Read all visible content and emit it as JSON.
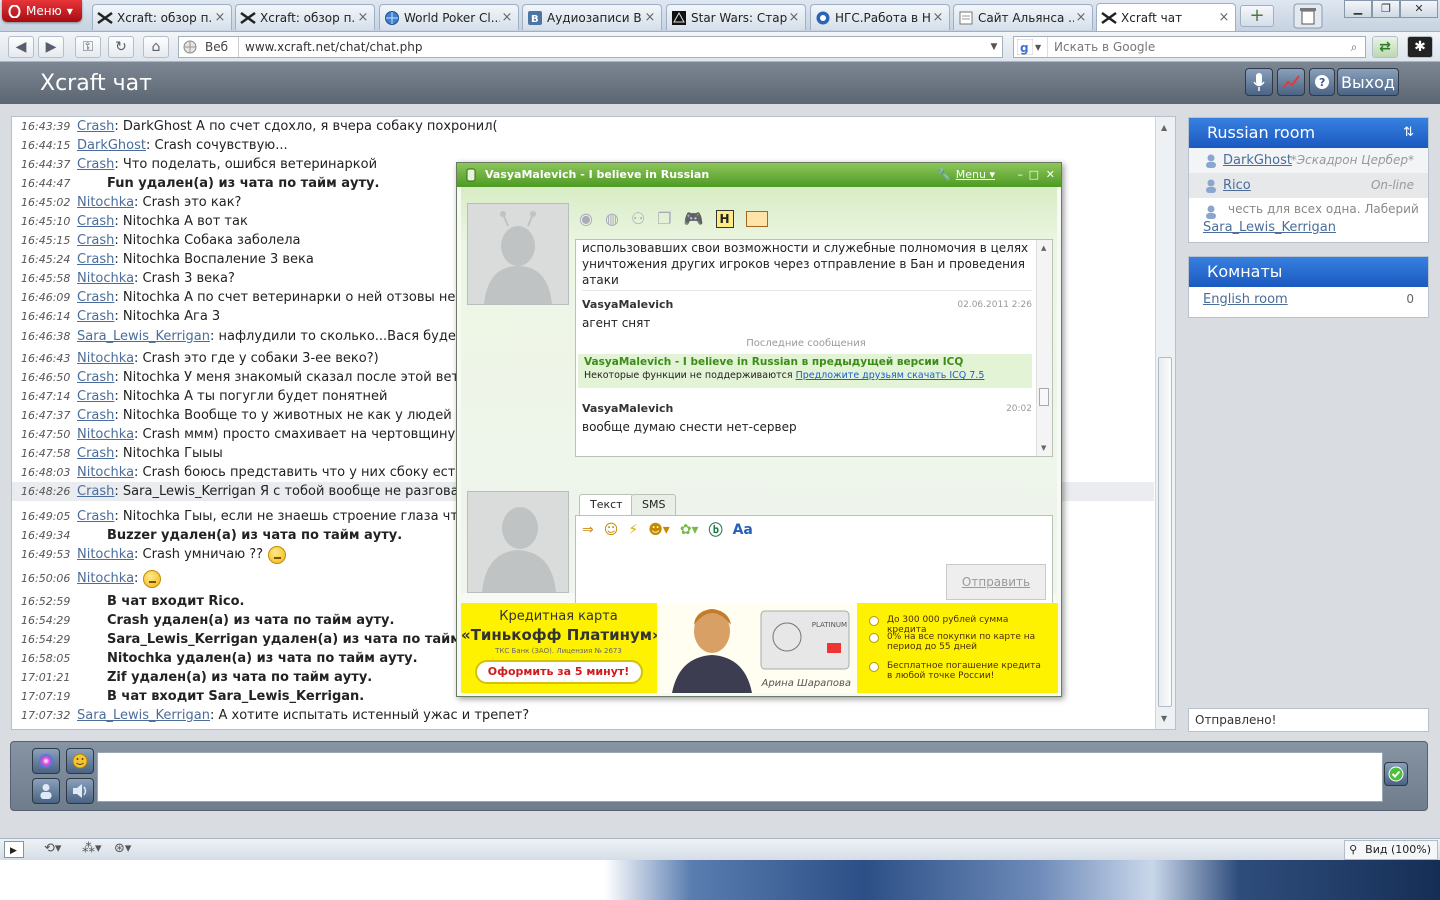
{
  "browser": {
    "menu_label": "Меню",
    "tabs": [
      {
        "title": "Xcraft: обзор п...",
        "icon": "xcraft-icon"
      },
      {
        "title": "Xcraft: обзор п...",
        "icon": "xcraft-icon"
      },
      {
        "title": "World Poker Cl...",
        "icon": "globe-icon"
      },
      {
        "title": "Аудиозаписи В...",
        "icon": "vk-icon"
      },
      {
        "title": "Star Wars: Стар...",
        "icon": "starwars-icon"
      },
      {
        "title": "НГС.Работа в Н...",
        "icon": "ngs-icon"
      },
      {
        "title": "Сайт Альянса ...",
        "icon": "page-icon"
      },
      {
        "title": "Xcraft чат",
        "icon": "xcraft-icon"
      }
    ],
    "close_glyph": "×",
    "new_tab_glyph": "+",
    "web_label": "Веб",
    "url": "www.xcraft.net/chat/chat.php",
    "search_placeholder": "Искать в Google",
    "zoom_label": "Вид (100%)"
  },
  "site": {
    "title": "Xcraft чат",
    "logout_label": "Выход"
  },
  "chat": {
    "lines": [
      {
        "time": "16:43:39",
        "nick": "Crash",
        "text": ": DarkGhost А по счет сдохло, я вчера собаку похронил("
      },
      {
        "time": "16:44:15",
        "nick": "DarkGhost",
        "text": ": Crash сочувствую..."
      },
      {
        "time": "16:44:37",
        "nick": "Crash",
        "text": ": Что поделать, ошибся ветеринаркой"
      },
      {
        "time": "16:44:47",
        "nick": "",
        "text": "Fun удален(а) из чата по тайм ауту."
      },
      {
        "time": "16:45:02",
        "nick": "Nitochka",
        "text": ": Crash это как?"
      },
      {
        "time": "16:45:10",
        "nick": "Crash",
        "text": ": Nitochka А вот так"
      },
      {
        "time": "16:45:15",
        "nick": "Crash",
        "text": ": Nitochka Собака заболела"
      },
      {
        "time": "16:45:24",
        "nick": "Crash",
        "text": ": Nitochka Воспаление 3 века"
      },
      {
        "time": "16:45:58",
        "nick": "Nitochka",
        "text": ": Crash 3 века?"
      },
      {
        "time": "16:46:09",
        "nick": "Crash",
        "text": ": Nitochka А по счет ветеринарки о ней отзовы не оч"
      },
      {
        "time": "16:46:14",
        "nick": "Crash",
        "text": ": Nitochka Ага 3"
      },
      {
        "time": "16:46:38",
        "nick": "Sara_Lewis_Kerrigan",
        "text": ": нафлудили то сколько...Вася будет д"
      },
      {
        "time": "16:46:43",
        "nick": "Nitochka",
        "text": ": Crash это где у собаки 3-ее веко?)"
      },
      {
        "time": "16:46:50",
        "nick": "Crash",
        "text": ": Nitochka У меня знакомый сказал после этой ветери"
      },
      {
        "time": "16:47:14",
        "nick": "Crash",
        "text": ": Nitochka А ты погугли будет понятней"
      },
      {
        "time": "16:47:37",
        "nick": "Crash",
        "text": ": Nitochka Вообще то у животных не как у людей у н"
      },
      {
        "time": "16:47:50",
        "nick": "Nitochka",
        "text": ": Crash ммм) просто смахивает на чертовщину))"
      },
      {
        "time": "16:47:58",
        "nick": "Crash",
        "text": ": Nitochka Гыыы"
      },
      {
        "time": "16:48:03",
        "nick": "Nitochka",
        "text": ": Crash боюсь представить что у них сбоку есть)"
      },
      {
        "time": "16:48:26",
        "nick": "Crash",
        "text": ": Sara_Lewis_Kerrigan Я с тобой вообще не разговар"
      },
      {
        "time": "16:49:05",
        "nick": "Crash",
        "text": ": Nitochka Гыы, если не знаешь строение глаза что у"
      },
      {
        "time": "16:49:34",
        "nick": "",
        "text": "Buzzer удален(а) из чата по тайм ауту."
      },
      {
        "time": "16:49:53",
        "nick": "Nitochka",
        "text": ": Crash умничаю ??"
      },
      {
        "time": "16:50:06",
        "nick": "Nitochka",
        "text": ":"
      },
      {
        "time": "16:52:59",
        "nick": "",
        "text": "В чат входит Rico."
      },
      {
        "time": "16:54:29",
        "nick": "",
        "text": "Crash удален(а) из чата по тайм ауту."
      },
      {
        "time": "16:54:29",
        "nick": "",
        "text": "Sara_Lewis_Kerrigan удален(а) из чата по тайм ау"
      },
      {
        "time": "16:58:05",
        "nick": "",
        "text": "Nitochka удален(а) из чата по тайм ауту."
      },
      {
        "time": "17:01:21",
        "nick": "",
        "text": "Zif удален(а) из чата по тайм ауту."
      },
      {
        "time": "17:07:19",
        "nick": "",
        "text": "В чат входит Sara_Lewis_Kerrigan."
      },
      {
        "time": "17:07:32",
        "nick": "Sara_Lewis_Kerrigan",
        "text": ": А хотите испытать истенный ужас и трепет?"
      }
    ]
  },
  "room": {
    "title": "Russian room",
    "users": [
      {
        "name": "DarkGhost",
        "status": "*Эскадрон Цербер*"
      },
      {
        "name": "Rico",
        "status": "On-line"
      }
    ],
    "extra_text": "честь для всех одна. Лаберий",
    "extra_user": "Sara_Lewis_Kerrigan"
  },
  "rooms": {
    "title": "Комнаты",
    "list": [
      {
        "name": "English room",
        "count": "0"
      }
    ]
  },
  "status_text": "Отправлено!",
  "icq": {
    "title": "VasyaMalevich - I believe in Russian",
    "menu_label": "Menu",
    "history_top": "использовавших свои возможности и служебные полномочия в целях уничтожения других игроков через отправление в Бан и проведения атаки",
    "msg1": {
      "name": "VasyaMalevich",
      "time": "02.06.2011 2:26",
      "text": "агент снят"
    },
    "recent_label": "Последние сообщения",
    "notice_title": "VasyaMalevich - I believe in Russian в предыдущей версии ICQ",
    "notice_text": "Некоторые функции не поддерживаются",
    "notice_link": "Предложите друзьям скачать ICQ 7.5",
    "msg2": {
      "name": "VasyaMalevich",
      "time": "20:02",
      "text": "вообще думаю снести нет-сервер"
    },
    "tab_text": "Текст",
    "tab_sms": "SMS",
    "send_label": "Отправить",
    "ad": {
      "line1": "Кредитная карта",
      "line2": "«Тинькофф Платинум»",
      "small": "ТКС Банк (ЗАО). Лицензия № 2673",
      "button": "Оформить за 5 минут!",
      "card_name": "Арина Шарапова",
      "card_brand": "PLATINUM",
      "bullets": [
        "До 300 000 рублей сумма кредита",
        "0% на все покупки по карте на период до 55 дней",
        "Бесплатное погашение кредита в любой точке России!"
      ]
    }
  },
  "colors": {
    "accent": "#1e5fc6",
    "icq_green": "#5aa52e",
    "ad_yellow": "#fff200"
  }
}
